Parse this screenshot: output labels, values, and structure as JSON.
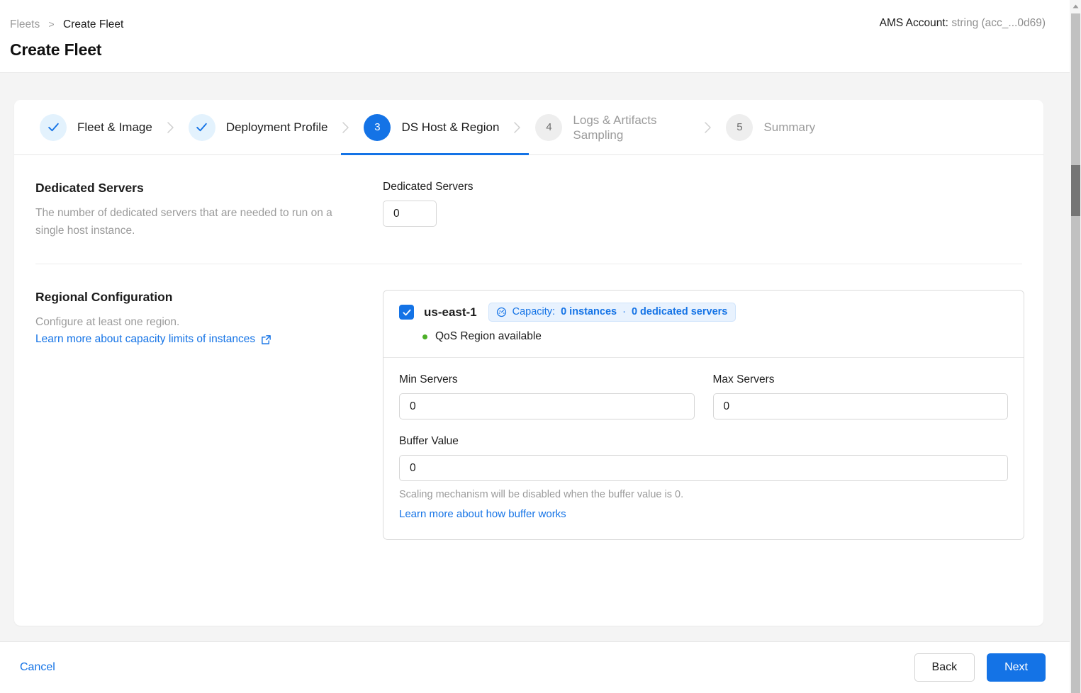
{
  "header": {
    "breadcrumb": {
      "root": "Fleets",
      "separator": ">",
      "current": "Create Fleet"
    },
    "title": "Create Fleet",
    "account_label": "AMS Account:",
    "account_value": "string (acc_...0d69)"
  },
  "stepper": {
    "steps": [
      {
        "number": "1",
        "label": "Fleet & Image",
        "state": "done",
        "icon": "check-icon"
      },
      {
        "number": "2",
        "label": "Deployment Profile",
        "state": "done",
        "icon": "check-icon"
      },
      {
        "number": "3",
        "label": "DS Host & Region",
        "state": "active"
      },
      {
        "number": "4",
        "label": "Logs & Artifacts Sampling",
        "state": "todo"
      },
      {
        "number": "5",
        "label": "Summary",
        "state": "todo"
      }
    ]
  },
  "dedicated_servers": {
    "title": "Dedicated Servers",
    "description": "The number of dedicated servers that are needed to run on a single host instance.",
    "field_label": "Dedicated Servers",
    "value": "0"
  },
  "regional_configuration": {
    "title": "Regional Configuration",
    "description": "Configure at least one region.",
    "link_text": "Learn more about capacity limits of instances",
    "link_icon": "external-link-icon",
    "region": {
      "checked": true,
      "name": "us-east-1",
      "badge_icon": "gauge-icon",
      "badge_prefix": "Capacity:",
      "badge_instances": "0 instances",
      "badge_separator": "·",
      "badge_dedicated": "0 dedicated servers",
      "qos_status": "QoS Region available",
      "qos_dot_color": "#4caf27",
      "min_servers_label": "Min Servers",
      "min_servers_value": "0",
      "max_servers_label": "Max Servers",
      "max_servers_value": "0",
      "buffer_label": "Buffer Value",
      "buffer_value": "0",
      "buffer_helper": "Scaling mechanism will be disabled when the buffer value is 0.",
      "buffer_link": "Learn more about how buffer works"
    }
  },
  "footer": {
    "cancel": "Cancel",
    "back": "Back",
    "next": "Next"
  },
  "colors": {
    "accent": "#1473e6",
    "badge_bg": "#e8f2fe",
    "page_bg": "#f4f4f4",
    "success": "#4caf27"
  }
}
